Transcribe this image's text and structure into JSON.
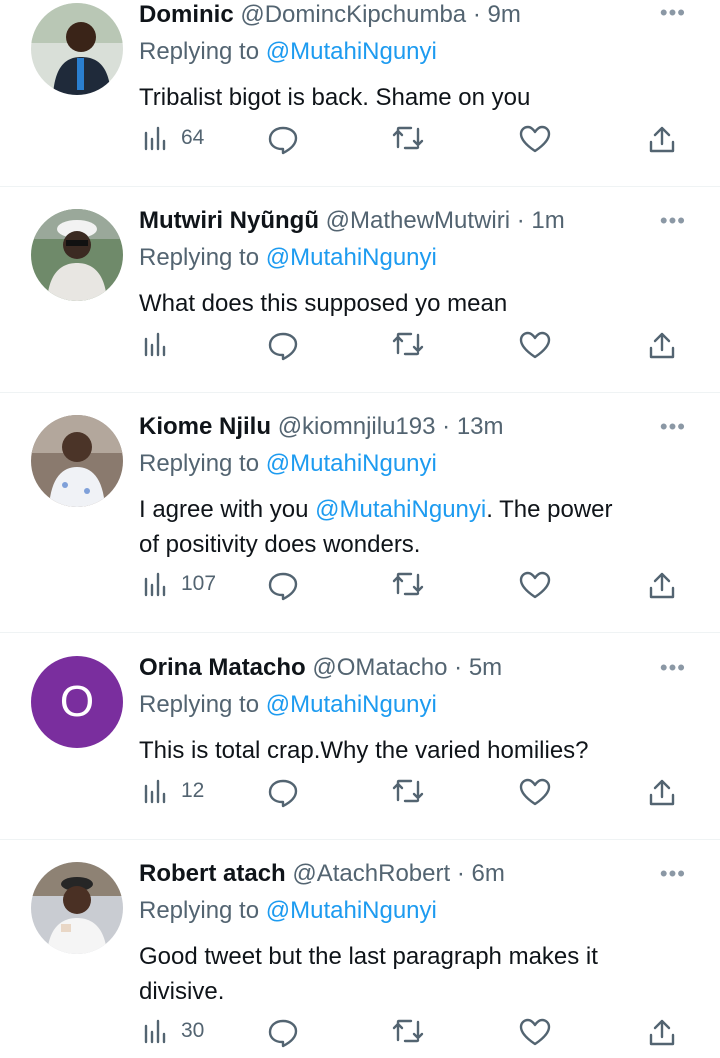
{
  "replying_prefix": "Replying to",
  "tweets": [
    {
      "name": "Dominic",
      "handle": "@DomincKipchumba",
      "time": "9m",
      "reply_to": "@MutahiNgunyi",
      "text_lines": [
        "Tribalist bigot is back. Shame on you"
      ],
      "views": "64"
    },
    {
      "name": "Mutwiri Nyũngũ",
      "handle": "@MathewMutwiri",
      "time": "1m",
      "reply_to": "@MutahiNgunyi",
      "text_lines": [
        "What does this supposed yo mean"
      ],
      "views": ""
    },
    {
      "name": "Kiome Njilu",
      "handle": "@kiomnjilu193",
      "time": "13m",
      "reply_to": "@MutahiNgunyi",
      "text_parts": {
        "before": "I agree with you ",
        "mention": "@MutahiNgunyi",
        "after": ". The power",
        "line2": "of positivity does wonders."
      },
      "views": "107"
    },
    {
      "name": "Orina Matacho",
      "handle": "@OMatacho",
      "time": "5m",
      "reply_to": "@MutahiNgunyi",
      "avatar_letter": "O",
      "avatar_color": "#7a2e9e",
      "text_lines": [
        "This is total crap.Why the varied homilies?"
      ],
      "views": "12"
    },
    {
      "name": "Robert atach",
      "handle": "@AtachRobert",
      "time": "6m",
      "reply_to": "@MutahiNgunyi",
      "text_lines": [
        "Good tweet but the last paragraph makes it",
        "divisive."
      ],
      "views": "30"
    }
  ],
  "icons": {
    "views": "bar-chart-icon",
    "reply": "speech-bubble-icon",
    "retweet": "retweet-icon",
    "like": "heart-icon",
    "share": "share-upload-icon",
    "more": "more-dots-icon"
  },
  "colors": {
    "link": "#1d9bf0",
    "secondary_text": "#536471",
    "primary_text": "#0f1419"
  }
}
